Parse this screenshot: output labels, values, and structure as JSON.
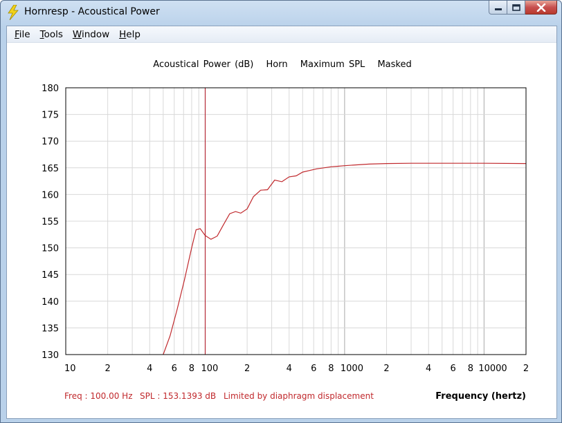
{
  "window": {
    "title": "Hornresp - Acoustical Power",
    "icon": "lightning-bolt-icon"
  },
  "menu": [
    {
      "label_first": "F",
      "label_rest": "ile"
    },
    {
      "label_first": "T",
      "label_rest": "ools"
    },
    {
      "label_first": "W",
      "label_rest": "indow"
    },
    {
      "label_first": "H",
      "label_rest": "elp"
    }
  ],
  "chart_title": {
    "part1": "Acoustical Power (dB)",
    "part2": "Horn",
    "part3": "Maximum SPL",
    "part4": "Masked"
  },
  "status": {
    "freq": "Freq : 100.00 Hz",
    "spl": "SPL : 153.1393 dB",
    "note": "Limited by diaphragm displacement"
  },
  "colors": {
    "curve": "#c0282c",
    "cursor": "#b01020",
    "grid": "#d8d8d8",
    "grid_decade": "#a8a8a8"
  },
  "chart_data": {
    "type": "line",
    "xlabel": "Frequency (hertz)",
    "ylabel": "",
    "xscale": "log",
    "xlim": [
      10,
      20000
    ],
    "ylim": [
      130,
      180
    ],
    "yticks": [
      "180",
      "175",
      "170",
      "165",
      "160",
      "155",
      "150",
      "145",
      "140",
      "135",
      "130"
    ],
    "xticks": [
      {
        "v": 10,
        "label": "10"
      },
      {
        "v": 20,
        "label": "2"
      },
      {
        "v": 40,
        "label": "4"
      },
      {
        "v": 60,
        "label": "6"
      },
      {
        "v": 80,
        "label": "8"
      },
      {
        "v": 100,
        "label": "100"
      },
      {
        "v": 200,
        "label": "2"
      },
      {
        "v": 400,
        "label": "4"
      },
      {
        "v": 600,
        "label": "6"
      },
      {
        "v": 800,
        "label": "8"
      },
      {
        "v": 1000,
        "label": "1000"
      },
      {
        "v": 2000,
        "label": "2"
      },
      {
        "v": 4000,
        "label": "4"
      },
      {
        "v": 6000,
        "label": "6"
      },
      {
        "v": 8000,
        "label": "8"
      },
      {
        "v": 10000,
        "label": "10000"
      },
      {
        "v": 20000,
        "label": "2"
      }
    ],
    "cursor_x": 100,
    "series": [
      {
        "x": [
          50,
          56,
          63,
          71,
          80,
          86,
          92,
          100,
          110,
          122,
          135,
          150,
          165,
          180,
          200,
          222,
          250,
          280,
          315,
          355,
          400,
          450,
          500,
          560,
          630,
          710,
          800,
          900,
          1000,
          1200,
          1500,
          2000,
          3000,
          5000,
          7000,
          10000,
          20000
        ],
        "y": [
          129.5,
          133.5,
          138.5,
          144.0,
          150.0,
          153.4,
          153.6,
          152.3,
          151.6,
          152.2,
          154.3,
          156.4,
          156.8,
          156.5,
          157.3,
          159.6,
          160.8,
          160.9,
          162.7,
          162.4,
          163.3,
          163.5,
          164.2,
          164.5,
          164.8,
          165.0,
          165.2,
          165.3,
          165.4,
          165.55,
          165.7,
          165.8,
          165.85,
          165.85,
          165.85,
          165.85,
          165.8
        ]
      }
    ]
  }
}
